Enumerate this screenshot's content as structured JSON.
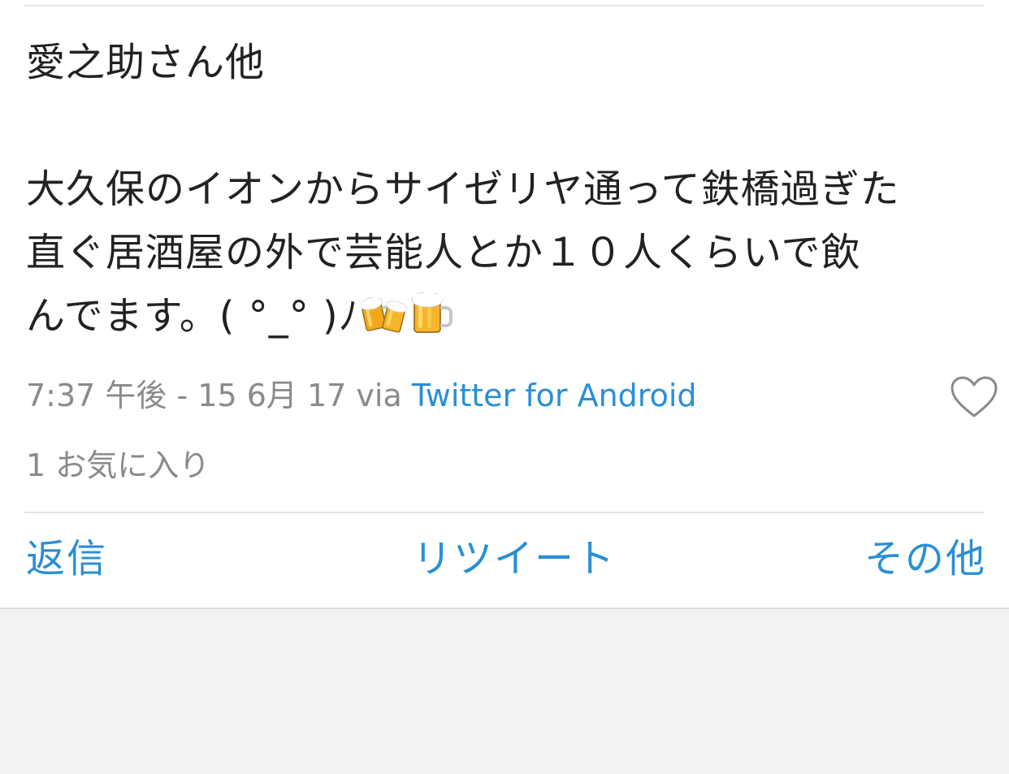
{
  "tweet": {
    "line1": "愛之助さん他",
    "line2": "大久保のイオンからサイゼリヤ通って鉄橋過ぎた",
    "line3": "直ぐ居酒屋の外で芸能人とか１０人くらいで飲",
    "line4": "んでます。( °_° )ﾉ",
    "emoji": [
      "clinking-beer-mugs-emoji",
      "beer-mug-emoji"
    ]
  },
  "meta": {
    "time": "7:37 午後 - 15 6月 17 via ",
    "client": "Twitter for Android"
  },
  "favorites": {
    "label": "1 お気に入り"
  },
  "actions": {
    "reply": "返信",
    "retweet": "リツイート",
    "more": "その他"
  },
  "colors": {
    "link": "#2a8fd4",
    "text": "#222222",
    "muted": "#8a8a8a",
    "background": "#f2f2f2"
  },
  "icons": {
    "favorite": "heart-outline-icon"
  }
}
